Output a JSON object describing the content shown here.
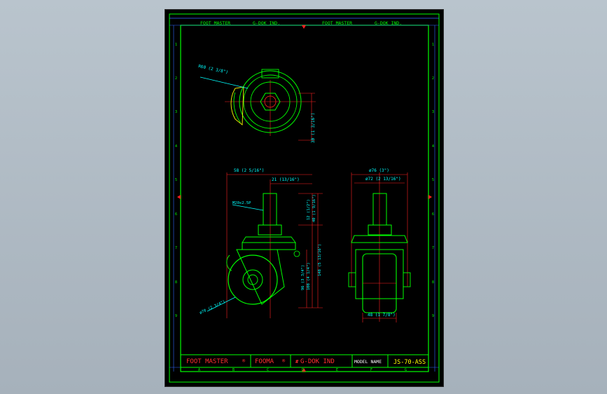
{
  "top_header": {
    "left_brand": "FOOT MASTER",
    "left_company": "G-DOK IND.",
    "right_brand": "FOOT MASTER",
    "right_company": "G-DOK IND."
  },
  "row_labels": [
    "1",
    "2",
    "3",
    "4",
    "5",
    "6",
    "7",
    "8",
    "9"
  ],
  "column_labels": [
    "A",
    "B",
    "C",
    "D",
    "E",
    "F",
    "G"
  ],
  "title_block": {
    "brand": "FOOT MASTER",
    "fooma": "FOOMA",
    "company": "G-DOK IND",
    "model_label": "MODEL NAME",
    "model_value": "JS-70-ASS"
  },
  "dimensions": {
    "top_radius": "R60 (2 3/8\")",
    "top_height": "30 (1 3/16\")",
    "width_overall": "58 (2 5/16\")",
    "offset": "21 (13/16\")",
    "thread": "M20x2.5P",
    "dim_12": "12 (1/2\")",
    "dim_40": "40 (1 9/16\")",
    "dim_96": "96 (3 3/4\")",
    "dim_108": "108 (4 1/4\")",
    "dim_148": "148 (5 13/16\")",
    "wheel_dia": "ø70 (2 3/4\")",
    "front_76": "ø76 (3\")",
    "front_72": "ø72 (2 13/16\")",
    "wheel_width": "48 (1 7/8\")"
  },
  "colors": {
    "frame": "#00ff00",
    "dimension": "#ff2020",
    "text": "#00ffff",
    "title": "#ff3030",
    "model": "#ffff00"
  }
}
